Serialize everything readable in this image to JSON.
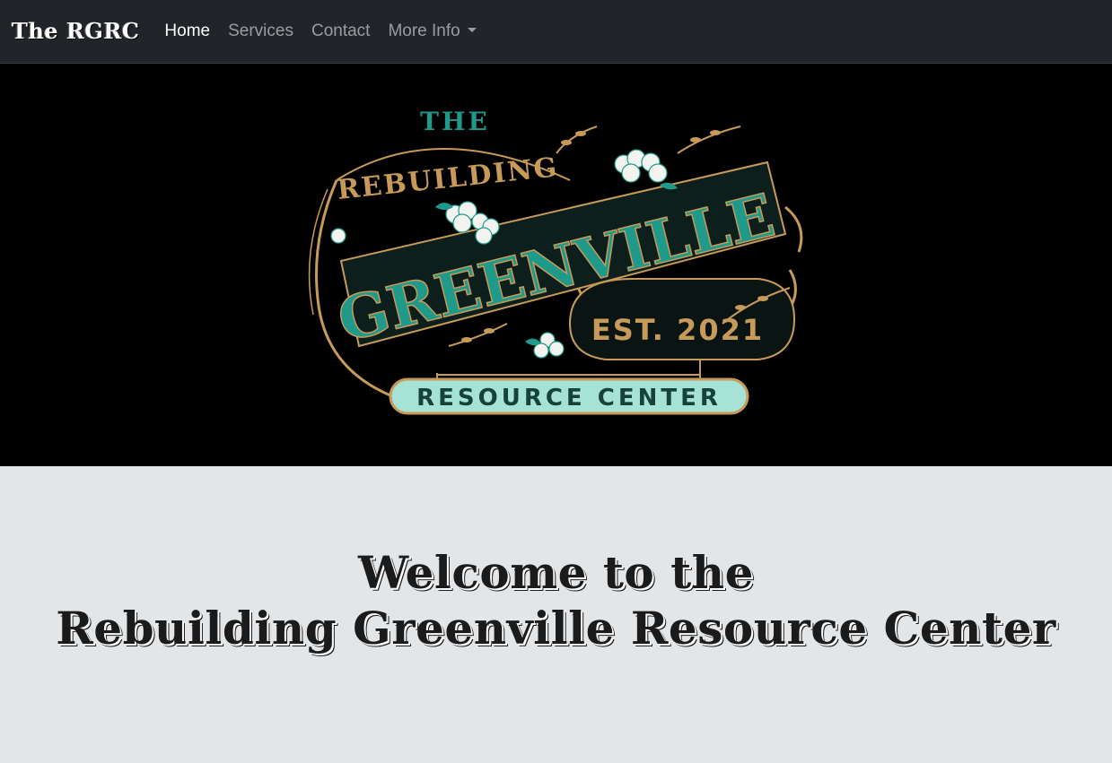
{
  "navbar": {
    "brand": "The RGRC",
    "links": [
      {
        "label": "Home",
        "active": true
      },
      {
        "label": "Services",
        "active": false
      },
      {
        "label": "Contact",
        "active": false
      }
    ],
    "dropdown_label": "More Info"
  },
  "hero": {
    "logo": {
      "the": "THE",
      "rebuilding": "REBUILDING",
      "greenville": "GREENVILLE",
      "est": "EST. 2021",
      "resource_center": "RESOURCE CENTER"
    },
    "colors": {
      "background": "#000000",
      "teal": "#1f9a8a",
      "gold": "#c79a5a",
      "mint": "#a6e3d6"
    }
  },
  "welcome": {
    "line1": "Welcome to the",
    "line2": "Rebuilding Greenville Resource Center"
  },
  "colors": {
    "navbar_bg": "#212529",
    "page_bg": "#e3e6e9",
    "nav_inactive": "#9a9da0"
  }
}
